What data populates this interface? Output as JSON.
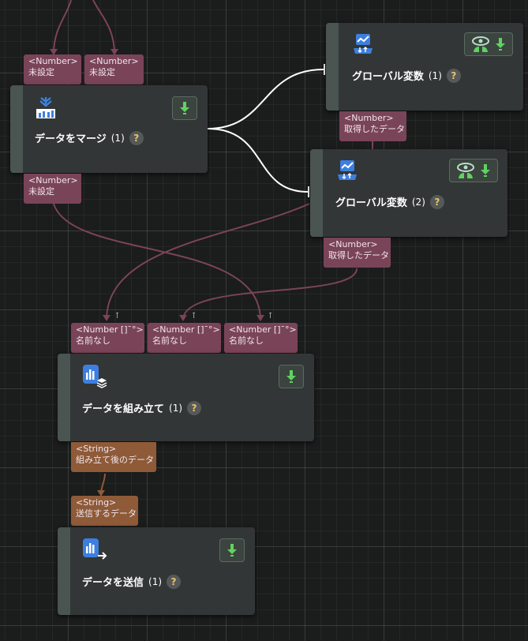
{
  "colors": {
    "number_port": "#7a4458",
    "string_port": "#8e5a38",
    "wire_number": "#7a4458",
    "wire_string": "#8e5a38",
    "wire_exec": "#ffffff",
    "download_icon": "#5fd35f",
    "preview_icon": "#b8ddc8",
    "node_icon": "#3d7fe0"
  },
  "nodes": {
    "merge": {
      "title": "データをマージ",
      "count": "(1)",
      "icon": "merge-icon",
      "inputs": [
        {
          "type": "<Number>",
          "label": "未設定"
        },
        {
          "type": "<Number>",
          "label": "未設定"
        }
      ],
      "output": {
        "type": "<Number>",
        "label": "未設定"
      }
    },
    "global1": {
      "title": "グローバル変数",
      "count": "(1)",
      "icon": "chart-icon",
      "output": {
        "type": "<Number>",
        "label": "取得したデータ"
      }
    },
    "global2": {
      "title": "グローバル変数",
      "count": "(2)",
      "icon": "chart-icon",
      "output": {
        "type": "<Number>",
        "label": "取得したデータ"
      }
    },
    "assemble": {
      "title": "データを組み立て",
      "count": "(1)",
      "icon": "assemble-icon",
      "pin_glyph": "⊺",
      "inputs": [
        {
          "type": "<Number []¯°>",
          "label": "名前なし"
        },
        {
          "type": "<Number []¯°>",
          "label": "名前なし"
        },
        {
          "type": "<Number []¯°>",
          "label": "名前なし"
        }
      ],
      "output": {
        "type": "<String>",
        "label": "組み立て後のデータ"
      }
    },
    "send": {
      "title": "データを送信",
      "count": "(1)",
      "icon": "send-icon",
      "input": {
        "type": "<String>",
        "label": "送信するデータ"
      }
    }
  },
  "help_label": "?"
}
